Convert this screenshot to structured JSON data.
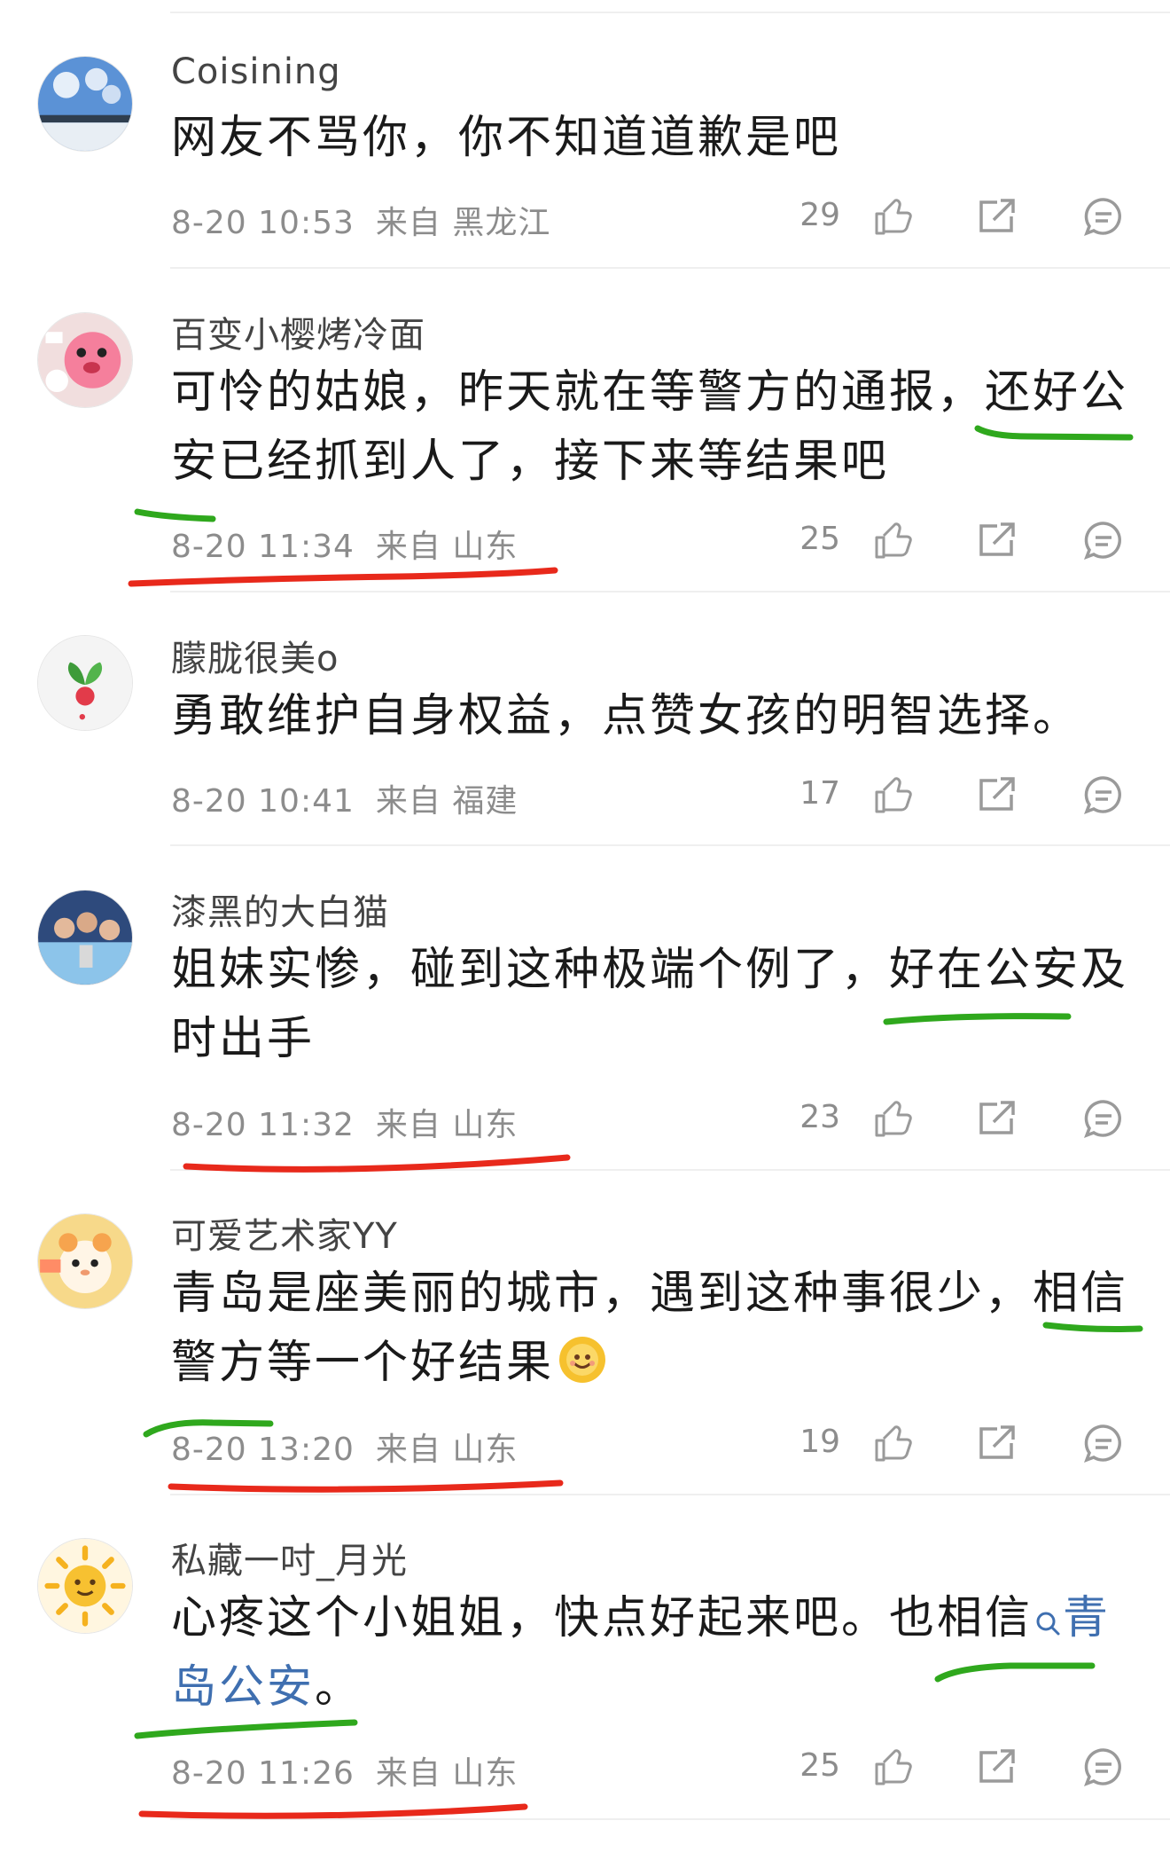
{
  "colors": {
    "link": "#3f6fb0",
    "meta": "#8c8c8c",
    "red_mark": "#e8291b",
    "green_mark": "#2fa81d"
  },
  "icons": {
    "like": "thumbs-up-icon",
    "share": "share-icon",
    "reply": "comment-icon"
  },
  "comments": [
    {
      "user": "Coisining",
      "text": "网友不骂你，你不知道道歉是吧",
      "time": "8-20 10:53",
      "location": "来自 黑龙江",
      "likes": "29",
      "avatar": "sky-landscape"
    },
    {
      "user": "百变小樱烤冷面",
      "text": "可怜的姑娘，昨天就在等警方的通报，还好公安已经抓到人了，接下来等结果吧",
      "time": "8-20 11:34",
      "location": "来自 山东",
      "likes": "25",
      "avatar": "pink-cartoon"
    },
    {
      "user": "朦胧很美o",
      "text": "勇敢维护自身权益，点赞女孩的明智选择。",
      "time": "8-20 10:41",
      "location": "来自 福建",
      "likes": "17",
      "avatar": "radish"
    },
    {
      "user": "漆黑的大白猫",
      "text": "姐妹实惨，碰到这种极端个例了，好在公安及时出手",
      "time": "8-20 11:32",
      "location": "来自 山东",
      "likes": "23",
      "avatar": "team-photo"
    },
    {
      "user": "可爱艺术家YY",
      "text_before_emoji": "青岛是座美丽的城市，遇到这种事很少，相信警方等一个好结果",
      "emoji": "sun-face-emoji",
      "time": "8-20 13:20",
      "location": "来自 山东",
      "likes": "19",
      "avatar": "plush-bear"
    },
    {
      "user": "私藏一吋_月光",
      "text_before_link": "心疼这个小姐姐，快点好起来吧。也相信",
      "link_text": "青岛公安",
      "text_after_link": "。",
      "time": "8-20 11:26",
      "location": "来自 山东",
      "likes": "25",
      "avatar": "sun-face"
    }
  ]
}
